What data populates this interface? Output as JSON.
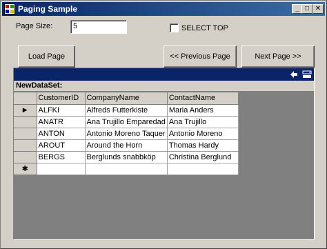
{
  "window": {
    "title": "Paging Sample",
    "controls": {
      "minimize": "_",
      "maximize": "□",
      "close": "✕"
    }
  },
  "form": {
    "page_size_label": "Page Size:",
    "page_size_value": "5",
    "select_top_label": "SELECT TOP",
    "select_top_checked": false
  },
  "buttons": {
    "load_page": "Load Page",
    "previous_page": "<< Previous Page",
    "next_page": "Next Page >>"
  },
  "grid": {
    "caption_icons": [
      "back-arrow-icon",
      "toggle-parent-rows-icon"
    ],
    "dataset_name": "NewDataSet:",
    "columns": [
      "CustomerID",
      "CompanyName",
      "ContactName"
    ],
    "rows": [
      [
        "ALFKI",
        "Alfreds Futterkiste",
        "Maria Anders"
      ],
      [
        "ANATR",
        "Ana Trujillo Emparedad",
        "Ana Trujillo"
      ],
      [
        "ANTON",
        "Antonio Moreno Taquer",
        "Antonio Moreno"
      ],
      [
        "AROUT",
        "Around the Horn",
        "Thomas Hardy"
      ],
      [
        "BERGS",
        "Berglunds snabbköp",
        "Christina Berglund"
      ]
    ],
    "current_row_marker": "▶",
    "new_row_marker": "✱"
  },
  "colors": {
    "window_face": "#d4d0c8",
    "titlebar_start": "#0a246a",
    "titlebar_end": "#3a6ea5",
    "grid_caption": "#0a246a",
    "grid_background": "#808080"
  }
}
